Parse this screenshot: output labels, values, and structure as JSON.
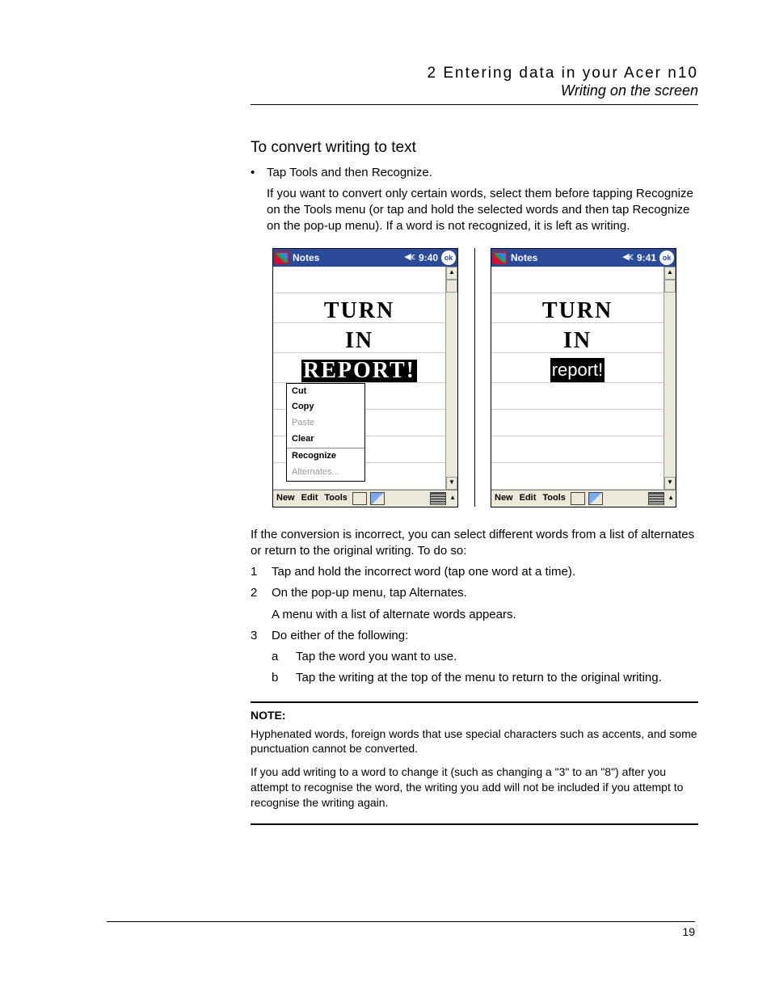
{
  "header": {
    "chapter": "2 Entering data in your Acer n10",
    "section": "Writing on the screen"
  },
  "section_title": "To convert writing to text",
  "bullet": "Tap Tools and then Recognize.",
  "bullet_explain": "If you want to convert only certain words, select them before tapping Recognize on the Tools menu (or tap and hold the selected words and then tap Recognize on the pop-up menu). If a word is not recognized, it is left as writing.",
  "screens": {
    "left": {
      "title": "Notes",
      "time": "9:40",
      "ok": "ok",
      "hand1": "TURN",
      "hand2": "IN",
      "hand3": "REPORT!",
      "popup": {
        "cut": "Cut",
        "copy": "Copy",
        "paste": "Paste",
        "clear": "Clear",
        "recognize": "Recognize",
        "alternates": "Alternates..."
      },
      "menubar": {
        "new_": "New",
        "edit": "Edit",
        "tools": "Tools"
      }
    },
    "right": {
      "title": "Notes",
      "time": "9:41",
      "ok": "ok",
      "hand1": "TURN",
      "hand2": "IN",
      "recognized": "report!",
      "menubar": {
        "new_": "New",
        "edit": "Edit",
        "tools": "Tools"
      }
    }
  },
  "after_figure": "If the conversion is incorrect, you can select different words from a list of alternates or return to the original writing. To do so:",
  "steps": {
    "s1_num": "1",
    "s1": "Tap and hold the incorrect word (tap one word at a time).",
    "s2_num": "2",
    "s2": "On the pop-up menu, tap Alternates.",
    "s2b": "A menu with a list of alternate words appears.",
    "s3_num": "3",
    "s3": "Do either of the following:",
    "s3a_mark": "a",
    "s3a": "Tap the word you want to use.",
    "s3b_mark": "b",
    "s3b": "Tap the writing at the top of the menu to return to the original writing."
  },
  "note": {
    "label": "NOTE:",
    "p1": "Hyphenated words, foreign words that use special characters such as accents, and some punctuation cannot be converted.",
    "p2": "If you add writing to a word to change it (such as changing a \"3\" to an \"8\") after you attempt to recognise the word, the writing you add will not be included if you attempt to recognise the writing again."
  },
  "page_number": "19",
  "glyphs": {
    "bullet": "•",
    "speaker": "◀ꞓ",
    "up": "▲",
    "down": "▼"
  }
}
